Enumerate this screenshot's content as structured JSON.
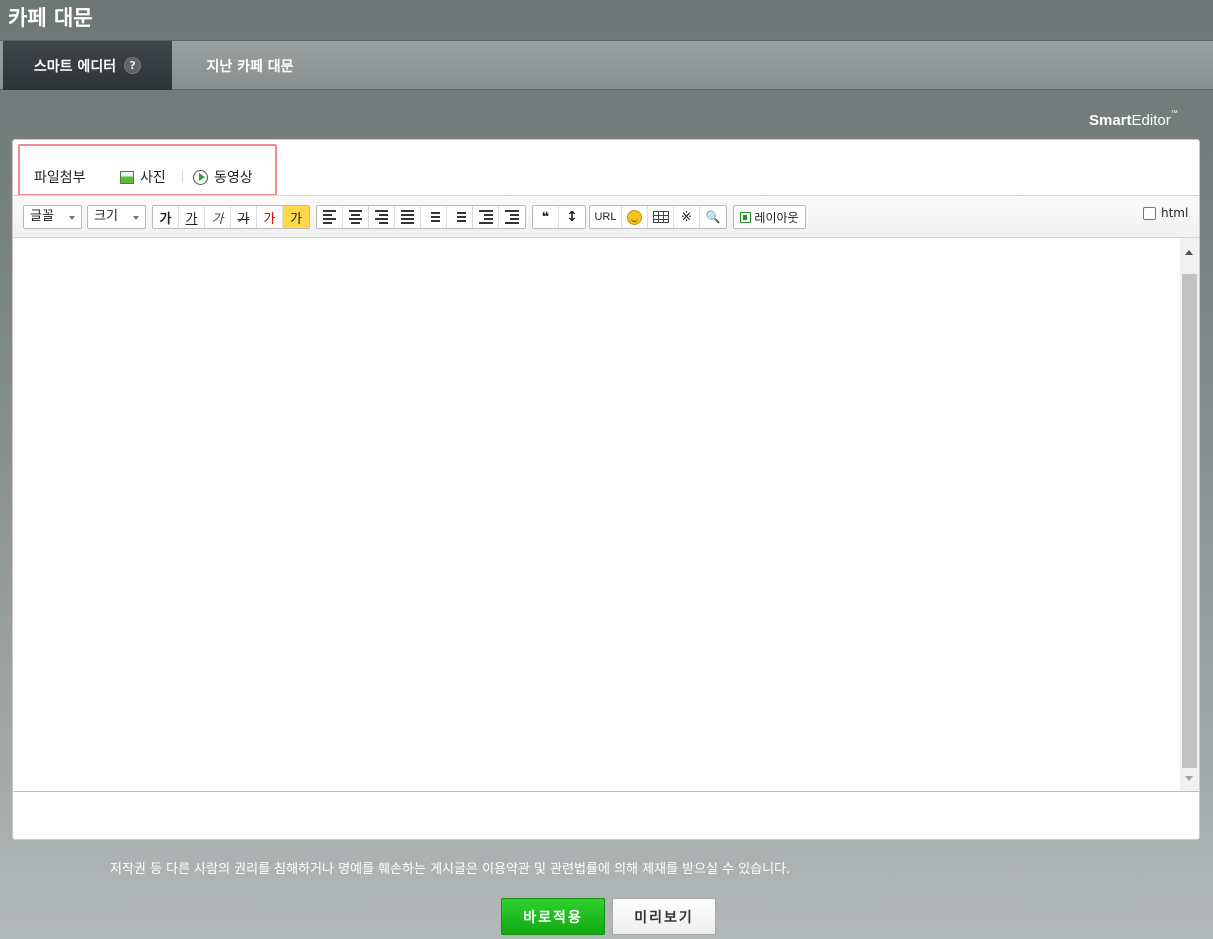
{
  "page": {
    "title": "카페 대문"
  },
  "tabs": [
    {
      "label": "스마트 에디터",
      "help": "?"
    },
    {
      "label": "지난 카페 대문"
    }
  ],
  "editor": {
    "logo_bold": "Smart",
    "logo_rest": "Editor",
    "logo_tm": "™",
    "attach": {
      "label": "파일첨부",
      "photo": "사진",
      "video": "동영상"
    },
    "toolbar": {
      "font_select": "글꼴",
      "size_select": "크기",
      "text_buttons": [
        "가",
        "가",
        "가",
        "가",
        "가",
        "가"
      ],
      "url": "URL",
      "reference_mark": "※",
      "quote": "❝",
      "layout": "레이아웃",
      "html_toggle": "html"
    }
  },
  "notice": "저작권 등 다른 사람의 권리를 침해하거나 명예를 훼손하는 게시글은 이용약관 및 관련법률에 의해 제재를 받으실 수 있습니다.",
  "buttons": {
    "apply": "바로적용",
    "preview": "미리보기"
  },
  "colors": {
    "apply_green": "#1bbf1b",
    "highlight": "#ffd84a",
    "attach_border": "#f08a94"
  }
}
